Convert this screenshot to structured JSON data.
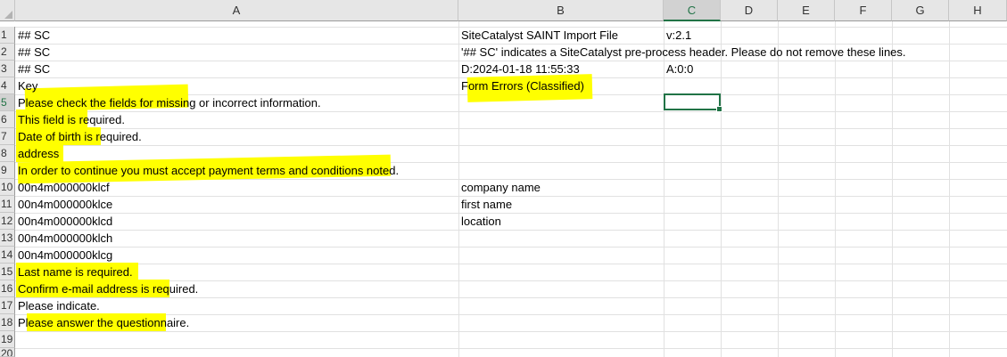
{
  "columns": [
    "A",
    "B",
    "C",
    "D",
    "E",
    "F",
    "G",
    "H"
  ],
  "selected_column": "C",
  "rows": [
    "1",
    "2",
    "3",
    "4",
    "5",
    "6",
    "7",
    "8",
    "9",
    "10",
    "11",
    "12",
    "13",
    "14",
    "15",
    "16",
    "17",
    "18",
    "19",
    "20"
  ],
  "selected_row": "5",
  "cells": {
    "A1": "## SC",
    "A2": "## SC",
    "A3": "## SC",
    "A4": "Key",
    "A5": "Please check the fields for missing or incorrect information.",
    "A6": "This field is required.",
    "A7": "Date of birth is required.",
    "A8": "address",
    "A9": "In order to continue you must accept payment terms and conditions noted.",
    "A10": "00n4m000000klcf",
    "A11": "00n4m000000klce",
    "A12": "00n4m000000klcd",
    "A13": "00n4m000000klch",
    "A14": "00n4m000000klcg",
    "A15": "Last name is required.",
    "A16": "Confirm e-mail address is required.",
    "A17": "Please indicate.",
    "A18": "Please answer the questionnaire.",
    "B1": "SiteCatalyst SAINT Import File",
    "B2": "'## SC' indicates a SiteCatalyst pre-process header. Please do not remove these lines.",
    "B3": "D:2024-01-18 11:55:33",
    "B4": "Form Errors (Classified)",
    "B10": "company name",
    "B11": "first name",
    "B12": "location",
    "C1": "v:2.1",
    "C3": "A:0:0"
  },
  "highlight_color": "#ffff00",
  "accent_color": "#217346"
}
